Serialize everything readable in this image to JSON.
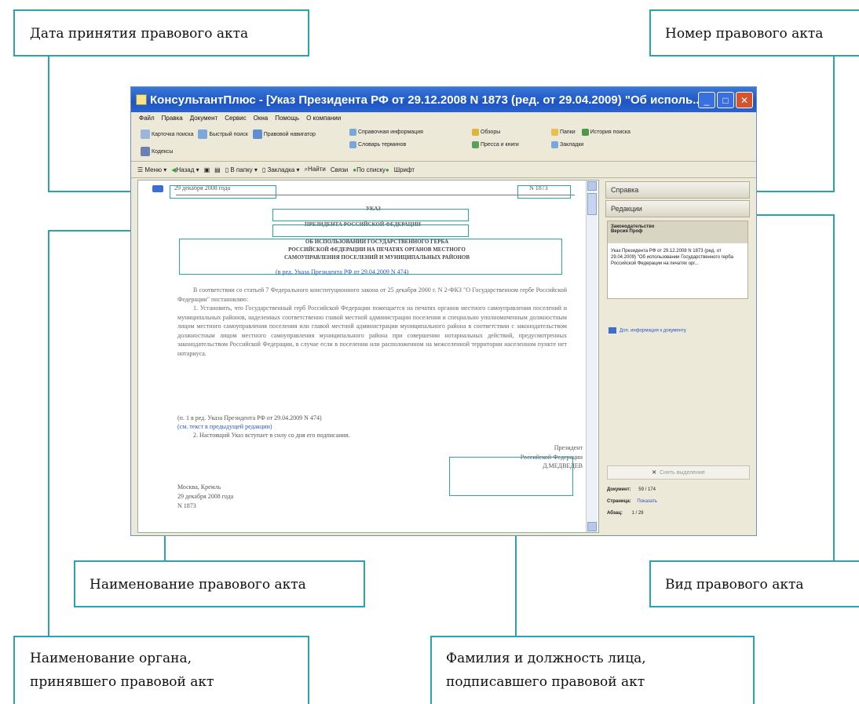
{
  "callouts": {
    "adoption_date": "Дата принятия правового акта",
    "act_number": "Номер правового акта",
    "act_name": "Наименование правового акта",
    "act_type": "Вид правового акта",
    "issuing_body": "Наименование органа,\nпринявшего правовой акт",
    "signatory": "Фамилия и должность лица,\nподписавшего правовой акт"
  },
  "window": {
    "title": "КонсультантПлюс - [Указ Президента РФ от 29.12.2008 N 1873 (ред. от 29.04.2009) \"Об исполь...",
    "menu": [
      "Файл",
      "Правка",
      "Документ",
      "Сервис",
      "Окна",
      "Помощь",
      "О компании"
    ],
    "ribbon": {
      "card": "Карточка поиска",
      "quick": "Быстрый поиск",
      "navigator": "Правовой навигатор",
      "codes": "Кодексы",
      "reference": "Справочная информация",
      "glossary": "Словарь терминов",
      "reviews": "Обзоры",
      "press": "Пресса и книги",
      "folders": "Папки",
      "bookmarks": "Закладки",
      "history": "История поиска"
    },
    "toolbar": {
      "menu": "Меню",
      "back": "Назад",
      "to_folder": "В папку",
      "bookmark": "Закладка",
      "find": "Найти",
      "links": "Связи",
      "by_list": "По списку",
      "font": "Шрифт"
    }
  },
  "document": {
    "date": "29 декабря 2008 года",
    "number": "N 1873",
    "type": "УКАЗ",
    "issuer": "ПРЕЗИДЕНТА РОССИЙСКОЙ ФЕДЕРАЦИИ",
    "title_lines": [
      "ОБ ИСПОЛЬЗОВАНИИ ГОСУДАРСТВЕННОГО ГЕРБА",
      "РОССИЙСКОЙ ФЕДЕРАЦИИ НА ПЕЧАТЯХ ОРГАНОВ МЕСТНОГО",
      "САМОУПРАВЛЕНИЯ ПОСЕЛЕНИЙ И МУНИЦИПАЛЬНЫХ РАЙОНОВ"
    ],
    "edition": "(в ред. Указа Президента РФ от 29.04.2009 N 474)",
    "para1": "В соответствии со статьей 7 Федерального конституционного закона от 25 декабря 2000 г. N 2-ФКЗ \"О Государственном гербе Российской Федерации\" постановляю:",
    "para2": "1. Установить, что Государственный герб Российской Федерации помещается на печатях органов местного самоуправления поселений и муниципальных районов, наделенных соответственно главой местной администрации поселения и специально уполномоченным должностным лицом местного самоуправления поселения или главой местной администрации муниципального района в соответствии с законодательством должностным лицом местного самоуправления муниципального района при совершении нотариальных действий, предусмотренных законодательством Российской Федерации, в случае если в поселении или расположенном на межселенной территории населенном пункте нет нотариуса.",
    "edition2": "(п. 1 в ред. Указа Президента РФ от 29.04.2009 N 474)",
    "prev_edition": "(см. текст в предыдущей редакции)",
    "para3": "2. Настоящий Указ вступает в силу со дня его подписания.",
    "signature": [
      "Президент",
      "Российской Федерации",
      "Д.МЕДВЕДЕВ"
    ],
    "footer": [
      "Москва, Кремль",
      "29 декабря 2008 года",
      "N 1873"
    ]
  },
  "panel": {
    "tab1": "Справка",
    "tab2": "Редакции",
    "box_head": "Законодательство\nВерсия Проф",
    "box_body": "Указ Президента РФ от 29.12.2008 N 1873 (ред. от 29.04.2009) \"Об использовании Государственного герба Российской Федерации на печатях орг...",
    "info_link": "Доп. информация к документу",
    "remove_sel": "Снять выделение",
    "doc_label": "Документ:",
    "doc_value": "59 / 174",
    "page_label": "Страница:",
    "page_value": "Показать",
    "para_label": "Абзац:",
    "para_value": "1 / 29"
  }
}
